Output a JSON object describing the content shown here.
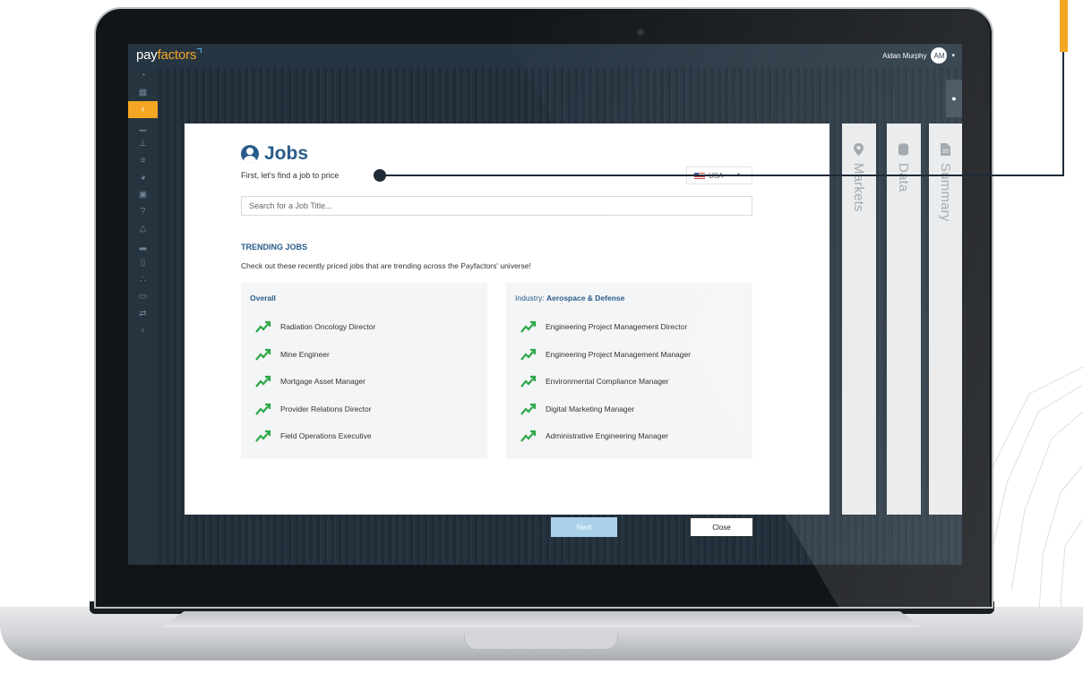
{
  "app": {
    "logo_prefix": "pay",
    "logo_suffix": "factors",
    "user_name": "Aidan Murphy",
    "user_initials": "AM"
  },
  "colors": {
    "accent": "#f5a623",
    "primary": "#285c8a",
    "trend_green": "#2ea84a",
    "next_button": "#a9d2ea"
  },
  "nav_icons": [
    "dashboard-icon",
    "calculator-icon",
    "lightbulb-icon",
    "area-chart-icon",
    "sitemap-icon",
    "list-icon",
    "pie-chart-icon",
    "truck-icon",
    "help-icon",
    "bell-icon",
    "bar-chart-icon",
    "document-icon",
    "users-icon",
    "id-card-icon",
    "exchange-icon",
    "lightbulb-outline-icon"
  ],
  "modal": {
    "title": "Jobs",
    "subtitle": "First, let's find a job to price",
    "country": "USA",
    "search_placeholder": "Search for a Job Title...",
    "trending_heading": "TRENDING JOBS",
    "trending_description": "Check out these recently priced jobs that are trending across the Payfactors' universe!",
    "overall": {
      "title": "Overall",
      "jobs": [
        "Radiation Oncology Director",
        "Mine Engineer",
        "Mortgage Asset Manager",
        "Provider Relations Director",
        "Field Operations Executive"
      ]
    },
    "industry": {
      "label": "Industry: ",
      "name": "Aerospace & Defense",
      "jobs": [
        "Engineering Project Management Director",
        "Engineering Project Management Manager",
        "Environmental Compliance Manager",
        "Digital Marketing Manager",
        "Administrative Engineering Manager"
      ]
    },
    "next_label": "Next",
    "close_label": "Close"
  },
  "side_tabs": [
    {
      "label": "Markets",
      "icon": "map-marker-icon"
    },
    {
      "label": "Data",
      "icon": "database-icon"
    },
    {
      "label": "Summary",
      "icon": "file-icon"
    }
  ]
}
